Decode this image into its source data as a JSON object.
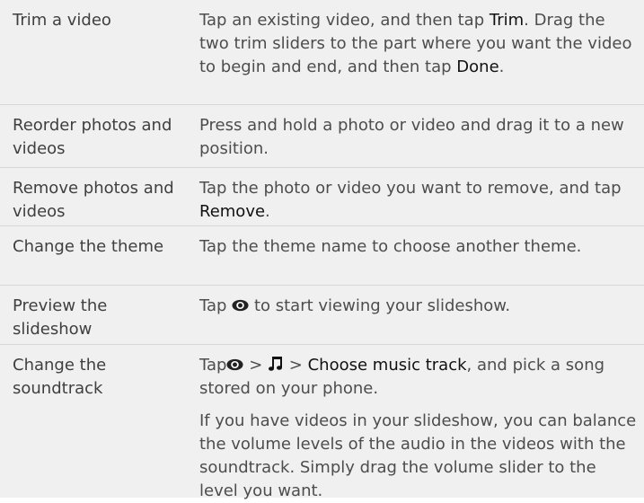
{
  "rows": [
    {
      "task": "Trim a video",
      "desc": [
        "Tap an existing video, and then tap ",
        "Trim",
        ". Drag the two trim sliders to the part where you want the video to begin and end, and then tap ",
        "Done",
        "."
      ]
    },
    {
      "task": "Reorder photos and videos",
      "desc": [
        "Press and hold a photo or video and drag it to a new position."
      ]
    },
    {
      "task": "Remove photos and videos",
      "desc": [
        "Tap the photo or video you want to remove, and tap ",
        "Remove",
        "."
      ]
    },
    {
      "task": "Change the theme",
      "desc": [
        "Tap the theme name to choose another theme."
      ]
    },
    {
      "task": "Preview the slideshow",
      "desc": [
        "Tap ",
        "to start viewing your slideshow."
      ]
    },
    {
      "task": "Change the soundtrack",
      "desc": [
        "Tap",
        ">",
        ">",
        "Choose music track",
        ", and pick a song stored on your phone."
      ],
      "desc2": "If you have videos in your slideshow, you can balance the volume levels of the audio in the videos with the soundtrack. Simply drag the volume slider to the level you want."
    }
  ],
  "icons": {
    "preview": "eye-icon",
    "music": "music-note-icon"
  }
}
